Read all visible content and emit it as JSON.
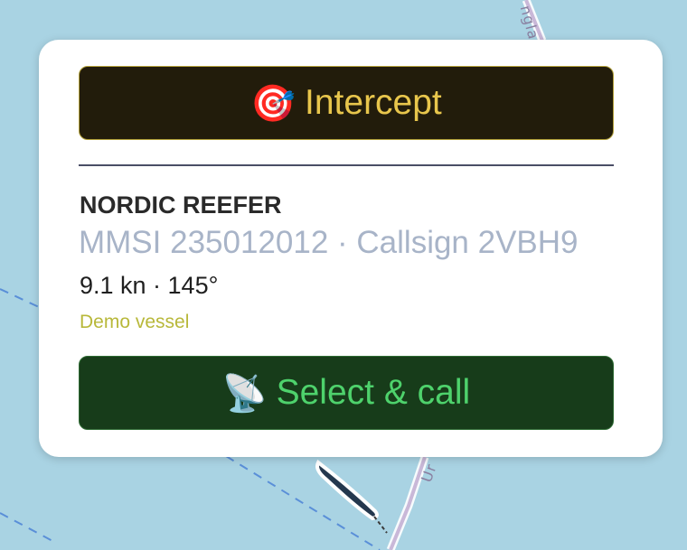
{
  "map": {
    "road_label_top": "ngla",
    "road_label_bottom": "Ur"
  },
  "popup": {
    "intercept_button": {
      "icon": "target-icon",
      "icon_glyph": "🎯",
      "label": "Intercept"
    },
    "vessel": {
      "name": "NORDIC REEFER",
      "ids_line": "MMSI 235012012 · Callsign 2VBH9",
      "speed_line": "9.1 kn · 145°",
      "note": "Demo vessel"
    },
    "select_call_button": {
      "icon": "satellite-dish-icon",
      "icon_glyph": "📡",
      "label": "Select & call"
    }
  },
  "colors": {
    "sea": "#a9d3e3",
    "intercept_bg": "#221c0b",
    "intercept_text": "#e8c64c",
    "call_bg": "#173c1a",
    "call_text": "#4ed26c",
    "vessel_marker": "#24384e"
  }
}
